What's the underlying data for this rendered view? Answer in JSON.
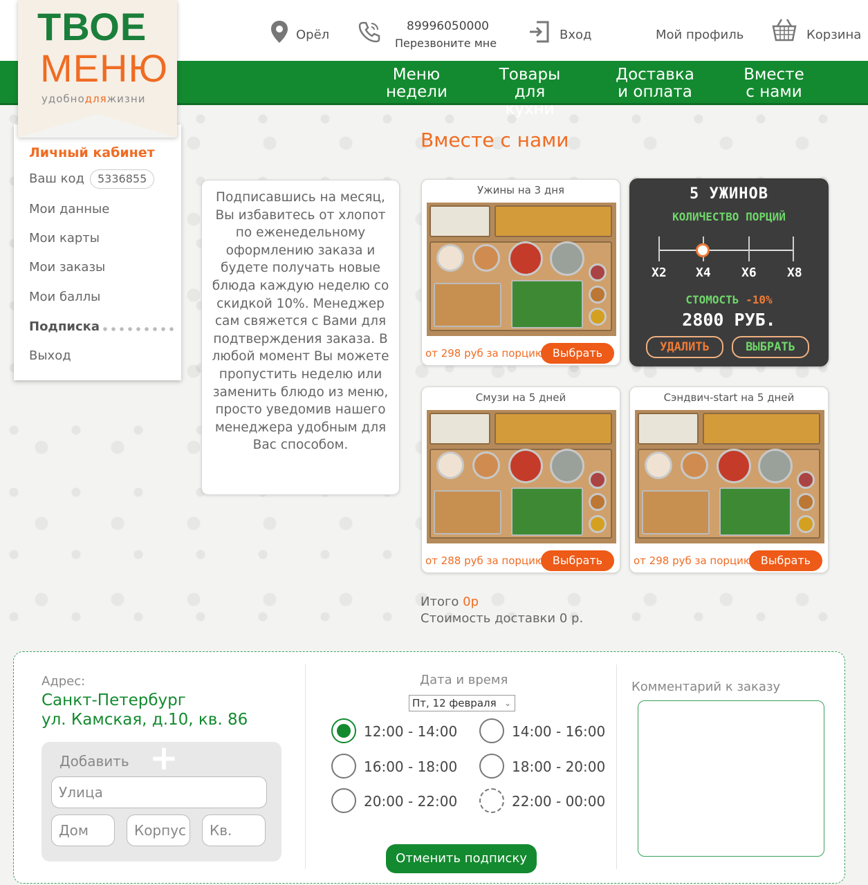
{
  "logo": {
    "line1": "ТВОЕ",
    "line2": "МЕНЮ",
    "tag_a": "удобно",
    "tag_b": "для",
    "tag_c": "жизни"
  },
  "header": {
    "city": "Орёл",
    "phone": "89996050000",
    "callback": "Перезвоните мне",
    "login": "Вход",
    "profile": "Мой профиль",
    "cart": "Корзина"
  },
  "nav": [
    {
      "l1": "Меню",
      "l2": "недели"
    },
    {
      "l1": "Товары",
      "l2": "для кухни"
    },
    {
      "l1": "Доставка",
      "l2": "и оплата"
    },
    {
      "l1": "Вместе",
      "l2": "с нами"
    }
  ],
  "sidebar": {
    "title": "Личный кабинет",
    "code_label": "Ваш код",
    "code": "5336855",
    "items": [
      "Мои данные",
      "Мои карты",
      "Мои заказы",
      "Мои баллы",
      "Подписка",
      "Выход"
    ]
  },
  "page_title": "Вместе с нами",
  "info_text": "Подписавшись на месяц, Вы избавитесь от хлопот по еженедельному оформлению заказа и будете получать новые блюда каждую неделю со скидкой 10%. Менеджер сам свяжется с Вами для подтверждения заказа. В любой момент Вы можете пропустить неделю или заменить блюдо из меню, просто уведомив нашего менеджера удобным для Вас способом.",
  "cards": [
    {
      "title": "Ужины на 3 дня",
      "price": "от 298 руб за порцию",
      "button": "Выбрать"
    },
    {
      "title": "Смузи на 5 дней",
      "price": "от 288 руб за порцию",
      "button": "Выбрать"
    },
    {
      "title": "Сэндвич-start на 5 дней",
      "price": "от 298 руб за порцию",
      "button": "Выбрать"
    }
  ],
  "chalk": {
    "title": "5 УЖИНОВ",
    "subtitle": "КОЛИЧЕСТВО ПОРЦИЙ",
    "options": [
      "X2",
      "X4",
      "X6",
      "X8"
    ],
    "selected_option": "X4",
    "cost_label": "СТОМОСТЬ",
    "discount": "-10%",
    "price": "2800 РУБ.",
    "delete": "УДАЛИТЬ",
    "choose": "ВЫБРАТЬ",
    "accent": "#f07a36"
  },
  "totals": {
    "label": "Итого",
    "value": "0р",
    "delivery": "Стоимость доставки 0 р."
  },
  "order": {
    "address_label": "Адрес:",
    "address_city": "Санкт-Петербург",
    "address_street": "ул. Камская, д.10, кв. 86",
    "add_label": "Добавить",
    "street_ph": "Улица",
    "house_ph": "Дом",
    "block_ph": "Корпус",
    "flat_ph": "Кв.",
    "datetime_label": "Дата и время",
    "date": "Пт, 12 февраля",
    "slots": [
      "12:00 - 14:00",
      "14:00 - 16:00",
      "16:00 - 18:00",
      "18:00 - 20:00",
      "20:00 - 22:00",
      "22:00 - 00:00"
    ],
    "selected_slot": "12:00 - 14:00",
    "cancel": "Отменить подписку",
    "comment_label": "Комментарий к заказу"
  },
  "colors": {
    "brand_green": "#138a2f",
    "brand_orange": "#ef6c23",
    "button_orange": "#ee5a17"
  }
}
